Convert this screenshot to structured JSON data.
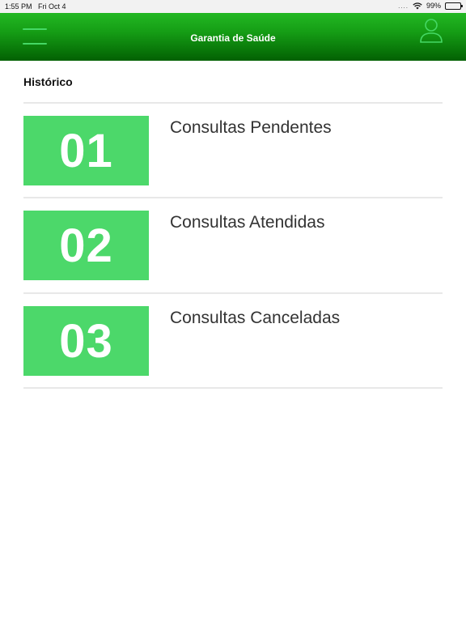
{
  "status_bar": {
    "time": "1:55 PM",
    "date": "Fri Oct 4",
    "signal": "....",
    "battery": "99%"
  },
  "header": {
    "title": "Garantia de Saúde",
    "accent_color": "#45d865",
    "background_color": "#0a7a0a"
  },
  "section": {
    "title": "Histórico"
  },
  "items": [
    {
      "number": "01",
      "label": "Consultas Pendentes"
    },
    {
      "number": "02",
      "label": "Consultas Atendidas"
    },
    {
      "number": "03",
      "label": "Consultas Canceladas"
    }
  ],
  "badge_color": "#4cd86a",
  "icons": {
    "menu": "hamburger-menu-icon",
    "profile": "user-profile-icon",
    "wifi": "wifi-icon",
    "battery": "battery-icon"
  }
}
